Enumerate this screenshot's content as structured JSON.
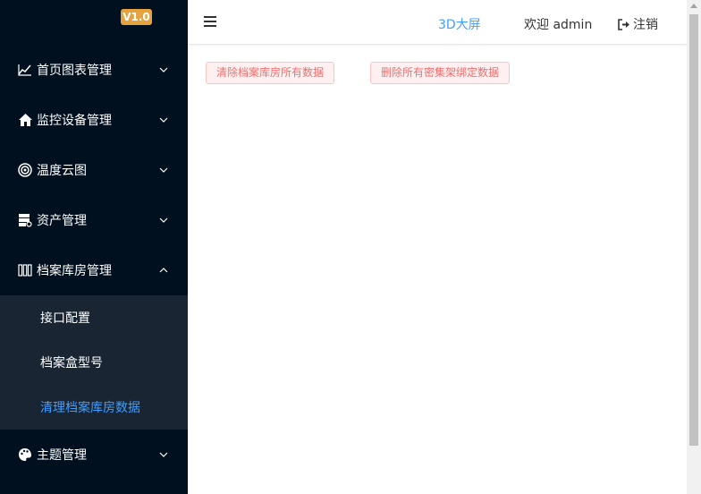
{
  "sidebar": {
    "version": "V1.0",
    "items": [
      {
        "label": "首页图表管理",
        "icon": "line-chart-icon",
        "expanded": false
      },
      {
        "label": "监控设备管理",
        "icon": "home-icon",
        "expanded": false
      },
      {
        "label": "温度云图",
        "icon": "target-icon",
        "expanded": false
      },
      {
        "label": "资产管理",
        "icon": "server-icon",
        "expanded": false
      },
      {
        "label": "档案库房管理",
        "icon": "archive-columns-icon",
        "expanded": true
      },
      {
        "label": "主题管理",
        "icon": "palette-icon",
        "expanded": false
      }
    ],
    "submenu": [
      {
        "label": "接口配置",
        "active": false
      },
      {
        "label": "档案盒型号",
        "active": false
      },
      {
        "label": "清理档案库房数据",
        "active": true
      }
    ]
  },
  "header": {
    "link_3d": "3D大屏",
    "welcome": "欢迎 admin",
    "logout": "注销"
  },
  "main": {
    "buttons": [
      "清除档案库房所有数据",
      "删除所有密集架绑定数据"
    ]
  },
  "colors": {
    "sidebar_bg": "#00101f",
    "submenu_bg": "#1a2533",
    "accent": "#409eff",
    "badge": "#e6a23c",
    "danger_text": "#f56c6c",
    "danger_bg": "#fef0f0",
    "danger_border": "#fbc4c4"
  }
}
